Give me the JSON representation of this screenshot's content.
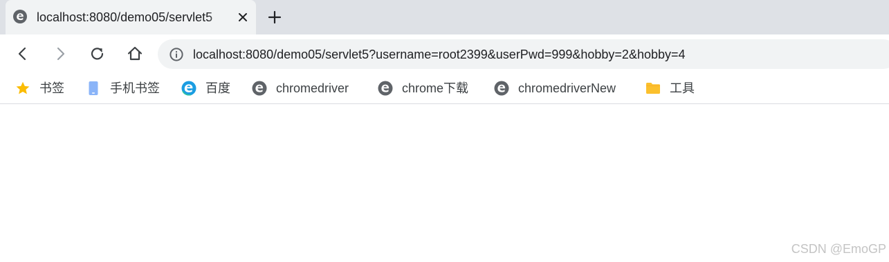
{
  "tab": {
    "title": "localhost:8080/demo05/servlet5",
    "favicon": "edge-globe-icon"
  },
  "toolbar": {
    "url": "localhost:8080/demo05/servlet5?username=root2399&userPwd=999&hobby=2&hobby=4"
  },
  "bookmarks": [
    {
      "label": "书签",
      "icon": "star-icon"
    },
    {
      "label": "手机书签",
      "icon": "mobile-icon"
    },
    {
      "label": "百度",
      "icon": "edge-icon"
    },
    {
      "label": "chromedriver",
      "icon": "globe-icon"
    },
    {
      "label": "chrome下载",
      "icon": "globe-icon"
    },
    {
      "label": "chromedriverNew",
      "icon": "globe-icon"
    },
    {
      "label": "工具",
      "icon": "folder-icon"
    }
  ],
  "watermark": "CSDN @EmoGP",
  "colors": {
    "tab_strip": "#dee1e6",
    "omnibox": "#f1f3f4",
    "star": "#fbbc04",
    "folder": "#fbc02d",
    "mobile": "#8ab4f8",
    "edge": "#1b9de2"
  }
}
